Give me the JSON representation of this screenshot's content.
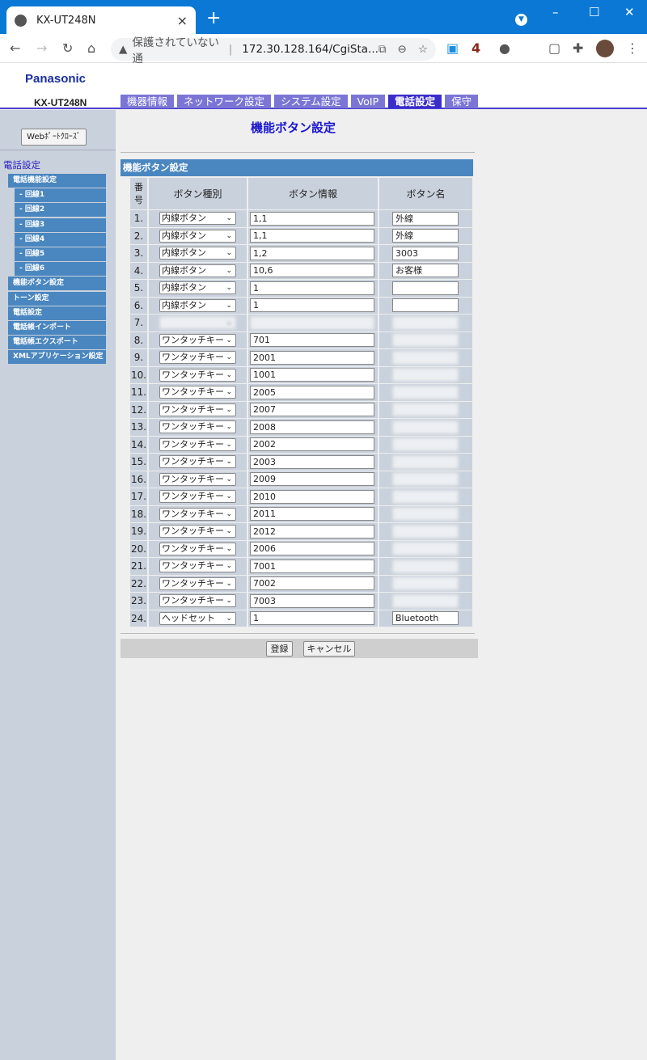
{
  "browser": {
    "tab_title": "KX-UT248N",
    "security_label": "保護されていない通",
    "url": "172.30.128.164/CgiSta...",
    "extension_badge": "4"
  },
  "header": {
    "brand": "Panasonic",
    "model": "KX-UT248N",
    "nav": [
      "機器情報",
      "ネットワーク設定",
      "システム設定",
      "VoIP",
      "電話設定",
      "保守"
    ],
    "active_nav": "電話設定"
  },
  "sidebar": {
    "web_port_close": "Webﾎﾟｰﾄｸﾛｰｽﾞ",
    "section": "電話設定",
    "items": [
      {
        "label": "電話機能設定",
        "sub": false
      },
      {
        "label": "- 回線1",
        "sub": true
      },
      {
        "label": "- 回線2",
        "sub": true
      },
      {
        "label": "- 回線3",
        "sub": true
      },
      {
        "label": "- 回線4",
        "sub": true
      },
      {
        "label": "- 回線5",
        "sub": true
      },
      {
        "label": "- 回線6",
        "sub": true
      },
      {
        "label": "機能ボタン設定",
        "sub": false
      },
      {
        "label": "トーン設定",
        "sub": false
      },
      {
        "label": "電話設定",
        "sub": false
      },
      {
        "label": "電話帳インポート",
        "sub": false
      },
      {
        "label": "電話帳エクスポート",
        "sub": false
      },
      {
        "label": "XMLアプリケーション設定",
        "sub": false
      }
    ]
  },
  "main": {
    "title": "機能ボタン設定",
    "section_title": "機能ボタン設定",
    "columns": {
      "num": "番号",
      "type": "ボタン種別",
      "info": "ボタン情報",
      "name": "ボタン名"
    },
    "rows": [
      {
        "num": "1.",
        "type": "内線ボタン",
        "info": "1,1",
        "name": "外線"
      },
      {
        "num": "2.",
        "type": "内線ボタン",
        "info": "1,1",
        "name": "外線"
      },
      {
        "num": "3.",
        "type": "内線ボタン",
        "info": "1,2",
        "name": "3003"
      },
      {
        "num": "4.",
        "type": "内線ボタン",
        "info": "10,6",
        "name": "お客様"
      },
      {
        "num": "5.",
        "type": "内線ボタン",
        "info": "1",
        "name": ""
      },
      {
        "num": "6.",
        "type": "内線ボタン",
        "info": "1",
        "name": ""
      },
      {
        "num": "7.",
        "type": null,
        "info": null,
        "name": null
      },
      {
        "num": "8.",
        "type": "ワンタッチキー",
        "info": "701",
        "name": null
      },
      {
        "num": "9.",
        "type": "ワンタッチキー",
        "info": "2001",
        "name": null
      },
      {
        "num": "10.",
        "type": "ワンタッチキー",
        "info": "1001",
        "name": null
      },
      {
        "num": "11.",
        "type": "ワンタッチキー",
        "info": "2005",
        "name": null
      },
      {
        "num": "12.",
        "type": "ワンタッチキー",
        "info": "2007",
        "name": null
      },
      {
        "num": "13.",
        "type": "ワンタッチキー",
        "info": "2008",
        "name": null
      },
      {
        "num": "14.",
        "type": "ワンタッチキー",
        "info": "2002",
        "name": null
      },
      {
        "num": "15.",
        "type": "ワンタッチキー",
        "info": "2003",
        "name": null
      },
      {
        "num": "16.",
        "type": "ワンタッチキー",
        "info": "2009",
        "name": null
      },
      {
        "num": "17.",
        "type": "ワンタッチキー",
        "info": "2010",
        "name": null
      },
      {
        "num": "18.",
        "type": "ワンタッチキー",
        "info": "2011",
        "name": null
      },
      {
        "num": "19.",
        "type": "ワンタッチキー",
        "info": "2012",
        "name": null
      },
      {
        "num": "20.",
        "type": "ワンタッチキー",
        "info": "2006",
        "name": null
      },
      {
        "num": "21.",
        "type": "ワンタッチキー",
        "info": "7001",
        "name": null
      },
      {
        "num": "22.",
        "type": "ワンタッチキー",
        "info": "7002",
        "name": null
      },
      {
        "num": "23.",
        "type": "ワンタッチキー",
        "info": "7003",
        "name": null
      },
      {
        "num": "24.",
        "type": "ヘッドセット",
        "info": "1",
        "name": "Bluetooth"
      }
    ],
    "save_label": "登録",
    "cancel_label": "キャンセル"
  }
}
